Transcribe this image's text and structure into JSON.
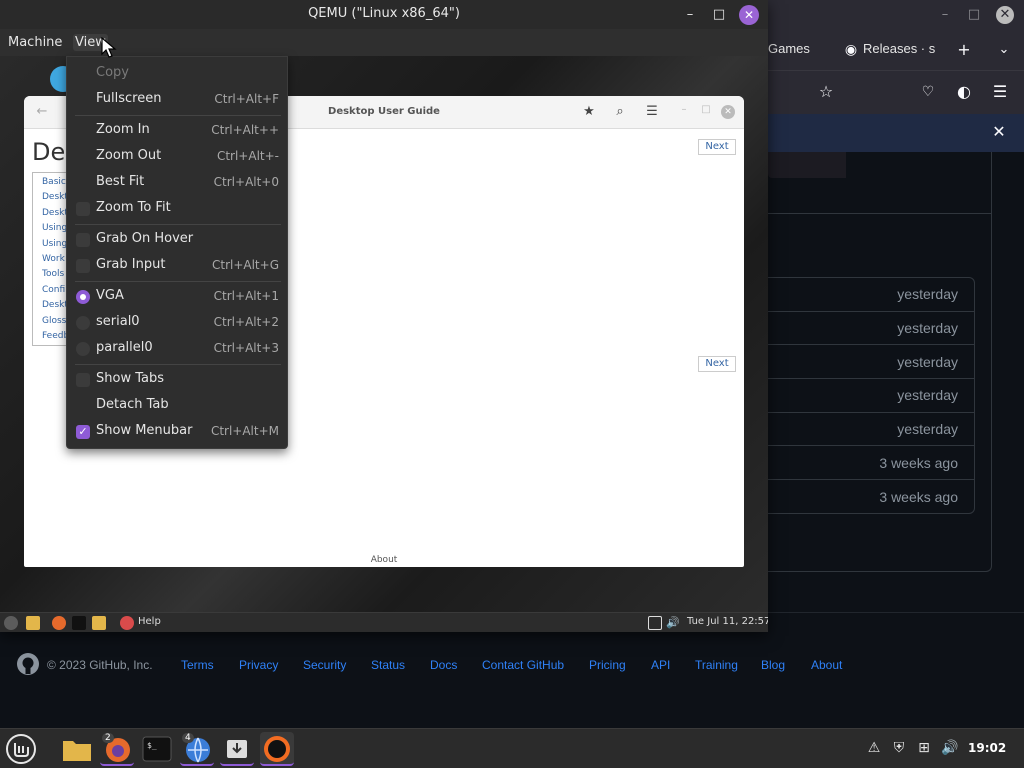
{
  "browser": {
    "tabs": [
      {
        "label": "Games"
      },
      {
        "label": "Releases · s"
      }
    ],
    "releases_times": [
      "yesterday",
      "yesterday",
      "yesterday",
      "yesterday",
      "yesterday",
      "3 weeks ago",
      "3 weeks ago"
    ],
    "footer": {
      "copyright": "© 2023 GitHub, Inc.",
      "links": [
        "Terms",
        "Privacy",
        "Security",
        "Status",
        "Docs",
        "Contact GitHub",
        "Pricing",
        "API",
        "Training",
        "Blog",
        "About"
      ]
    }
  },
  "qemu": {
    "title": "QEMU (\"Linux x86_64\")",
    "menubar": [
      "Machine",
      "View"
    ],
    "view_menu": [
      {
        "label": "Copy",
        "shortcut": "",
        "kind": "plain",
        "disabled": true
      },
      {
        "label": "Fullscreen",
        "shortcut": "Ctrl+Alt+F",
        "kind": "plain"
      },
      {
        "label": "Zoom In",
        "shortcut": "Ctrl+Alt++",
        "kind": "plain"
      },
      {
        "label": "Zoom Out",
        "shortcut": "Ctrl+Alt+-",
        "kind": "plain"
      },
      {
        "label": "Best Fit",
        "shortcut": "Ctrl+Alt+0",
        "kind": "plain"
      },
      {
        "label": "Zoom To Fit",
        "shortcut": "",
        "kind": "check",
        "checked": false
      },
      {
        "label": "Grab On Hover",
        "shortcut": "",
        "kind": "check",
        "checked": false
      },
      {
        "label": "Grab Input",
        "shortcut": "Ctrl+Alt+G",
        "kind": "check",
        "checked": false
      },
      {
        "label": "VGA",
        "shortcut": "Ctrl+Alt+1",
        "kind": "radio",
        "checked": true
      },
      {
        "label": "serial0",
        "shortcut": "Ctrl+Alt+2",
        "kind": "radio",
        "checked": false
      },
      {
        "label": "parallel0",
        "shortcut": "Ctrl+Alt+3",
        "kind": "radio",
        "checked": false
      },
      {
        "label": "Show Tabs",
        "shortcut": "",
        "kind": "check",
        "checked": false
      },
      {
        "label": "Detach Tab",
        "shortcut": "",
        "kind": "plain"
      },
      {
        "label": "Show Menubar",
        "shortcut": "Ctrl+Alt+M",
        "kind": "check",
        "checked": true
      }
    ],
    "guest": {
      "help_window": {
        "title": "Desktop User Guide",
        "heading": "Des",
        "toc": [
          "Basic",
          "Deskt",
          "Deskt",
          "Using",
          "Using",
          "Work",
          "Tools",
          "Confi",
          "Deskt",
          "Gloss",
          "Feedb"
        ],
        "next_label": "Next",
        "about_label": "About"
      },
      "panel": {
        "help_label": "Help",
        "clock": "Tue Jul 11, 22:57"
      }
    }
  },
  "taskbar": {
    "firefox_badge": "2",
    "browser_badge": "4",
    "clock": "19:02"
  },
  "colors": {
    "accent": "#8e5bd6",
    "github_link": "#2f81f7",
    "github_bg": "#0d1117"
  }
}
